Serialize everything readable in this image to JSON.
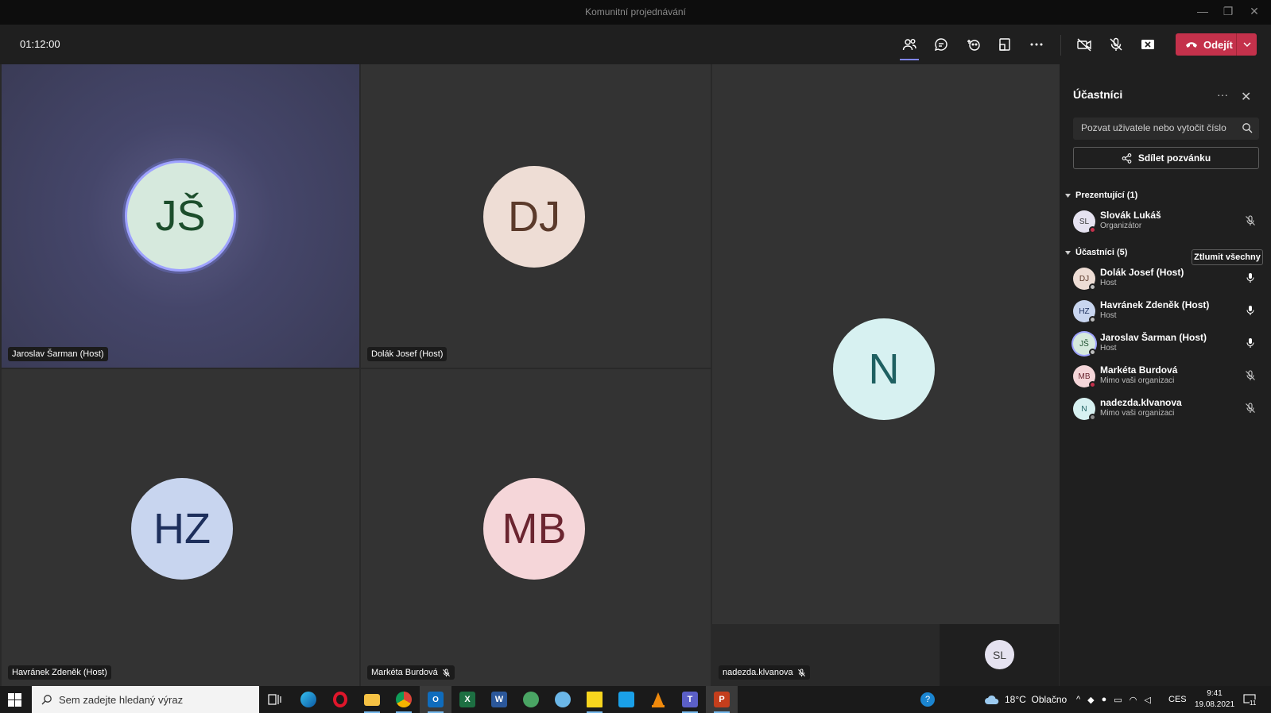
{
  "window": {
    "title": "Komunitní projednávání",
    "minimize": "—",
    "restore": "❐",
    "close": "✕"
  },
  "toolbar": {
    "timer": "01:12:00",
    "leave_label": "Odejít",
    "icons": [
      "people-icon",
      "chat-icon",
      "reactions-icon",
      "share-tray-icon",
      "more-icon",
      "camera-off-icon",
      "mic-off-icon",
      "share-screen-icon"
    ]
  },
  "tiles": [
    {
      "initials": "JŠ",
      "name": "Jaroslav Šarman (Host)",
      "avatar_bg": "#d6e9dd",
      "avatar_fg": "#1b4d2b",
      "active": true,
      "muted": false
    },
    {
      "initials": "DJ",
      "name": "Dolák Josef (Host)",
      "avatar_bg": "#eeddd5",
      "avatar_fg": "#5b3a2b",
      "active": false,
      "muted": false
    },
    {
      "initials": "N",
      "name": "nadezda.klvanova",
      "avatar_bg": "#d7f1f1",
      "avatar_fg": "#1e6061",
      "active": false,
      "muted": true
    },
    {
      "initials": "HZ",
      "name": "Havránek Zdeněk (Host)",
      "avatar_bg": "#c8d5ef",
      "avatar_fg": "#1d2f5c",
      "active": false,
      "muted": false
    },
    {
      "initials": "MB",
      "name": "Markéta Burdová",
      "avatar_bg": "#f5d6d9",
      "avatar_fg": "#6b2530",
      "active": false,
      "muted": true
    }
  ],
  "self_view": {
    "initials": "SL"
  },
  "panel": {
    "title": "Účastníci",
    "more": "···",
    "close": "✕",
    "invite_placeholder": "Pozvat uživatele nebo vytočit číslo",
    "share_invite": "Sdílet pozvánku",
    "presenters_header": "Prezentující (1)",
    "attendees_header": "Účastníci (5)",
    "mute_all": "Ztlumit všechny",
    "presenters": [
      {
        "initials": "SL",
        "name": "Slovák Lukáš",
        "role": "Organizátor",
        "avatar_bg": "#e5e2f0",
        "avatar_fg": "#3d3d3d",
        "status": "#c4314b",
        "muted": true
      }
    ],
    "attendees": [
      {
        "initials": "DJ",
        "name": "Dolák Josef (Host)",
        "role": "Host",
        "avatar_bg": "#eeddd5",
        "avatar_fg": "#5b3a2b",
        "status": "#bdbdbd",
        "muted": false
      },
      {
        "initials": "HZ",
        "name": "Havránek Zdeněk (Host)",
        "role": "Host",
        "avatar_bg": "#c8d5ef",
        "avatar_fg": "#1d2f5c",
        "status": "#bdbdbd",
        "muted": false
      },
      {
        "initials": "JŠ",
        "name": "Jaroslav Šarman (Host)",
        "role": "Host",
        "avatar_bg": "#d6e9dd",
        "avatar_fg": "#1b4d2b",
        "status": "#bdbdbd",
        "muted": false,
        "speaking": true
      },
      {
        "initials": "MB",
        "name": "Markéta Burdová",
        "role": "Mimo vaši organizaci",
        "avatar_bg": "#f5d6d9",
        "avatar_fg": "#6b2530",
        "status": "#c4314b",
        "muted": true
      },
      {
        "initials": "N",
        "name": "nadezda.klvanova",
        "role": "Mimo vaši organizaci",
        "avatar_bg": "#d7f1f1",
        "avatar_fg": "#1e6061",
        "status": "#8a8a8a",
        "muted": true
      }
    ]
  },
  "taskbar": {
    "search_placeholder": "Sem zadejte hledaný výraz",
    "weather": "18°C  Oblačno",
    "language": "CES",
    "time": "9:41",
    "date": "19.08.2021",
    "notification_count": "11",
    "apps": [
      "task-view",
      "edge",
      "opera",
      "file-explorer",
      "chrome",
      "outlook",
      "excel",
      "word",
      "network-app",
      "unknown-app",
      "sticky-notes",
      "store",
      "vlc",
      "teams",
      "powerpoint"
    ]
  }
}
